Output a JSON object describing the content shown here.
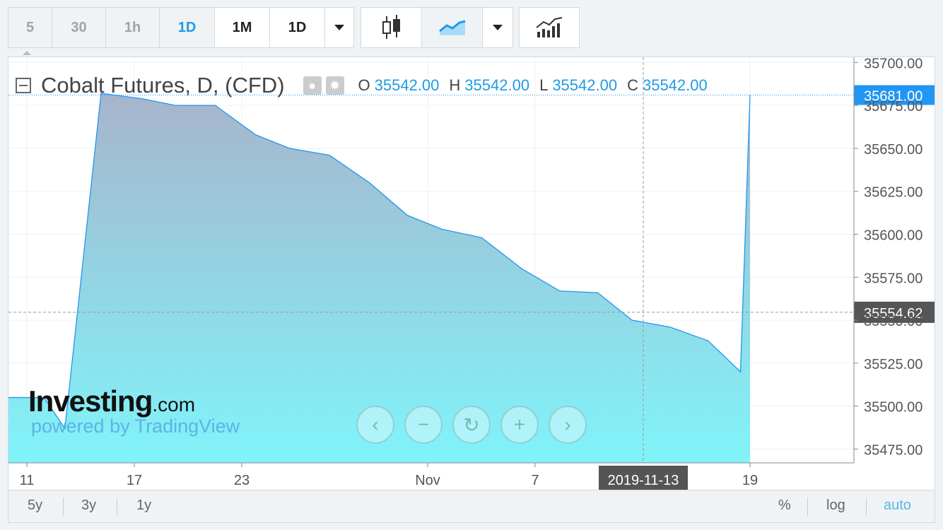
{
  "toolbar": {
    "intervals": [
      {
        "label": "5",
        "state": "disabled"
      },
      {
        "label": "30",
        "state": "disabled"
      },
      {
        "label": "1h",
        "state": "disabled"
      },
      {
        "label": "1D",
        "state": "active"
      },
      {
        "label": "1M",
        "state": "normal"
      },
      {
        "label": "1D",
        "state": "normal"
      }
    ]
  },
  "legend": {
    "title": "Cobalt Futures, D, (CFD)",
    "o_label": "O",
    "o_value": "35542.00",
    "h_label": "H",
    "h_value": "35542.00",
    "l_label": "L",
    "l_value": "35542.00",
    "c_label": "C",
    "c_value": "35542.00"
  },
  "price_labels": {
    "last": "35681.00",
    "crosshair": "35554.62",
    "crosshair_date": "2019-11-13"
  },
  "watermark": {
    "brand": "Investing",
    "domain": ".com",
    "powered": "powered by TradingView"
  },
  "bottom_bar": {
    "ranges": [
      "5y",
      "3y",
      "1y"
    ],
    "scale_options": [
      "%",
      "log",
      "auto"
    ]
  },
  "colors": {
    "line": "#2196f3",
    "accent": "#1e9be6",
    "fill_top": "#a7b4cc",
    "fill_bottom": "#80f4f9"
  },
  "chart_data": {
    "type": "area",
    "title": "Cobalt Futures, D, (CFD)",
    "xlabel": "",
    "ylabel": "",
    "x_ticks": [
      "11",
      "17",
      "23",
      "Nov",
      "7",
      "19"
    ],
    "y_ticks": [
      "35475.00",
      "35500.00",
      "35525.00",
      "35550.00",
      "35575.00",
      "35600.00",
      "35625.00",
      "35650.00",
      "35675.00",
      "35700.00"
    ],
    "ylim": [
      35467,
      35703
    ],
    "x": [
      -1.4,
      0.45,
      1.0,
      1.95,
      3.0,
      3.9,
      4.95,
      6.0,
      6.9,
      7.95,
      9.0,
      10.0,
      10.9,
      11.95,
      13.0,
      14.0,
      15.0,
      15.9,
      16.9,
      17.9,
      18.75,
      19.0
    ],
    "values": [
      35505,
      35505,
      35487,
      35682,
      35679,
      35675,
      35675,
      35658,
      35650,
      35646,
      35630,
      35611,
      35603,
      35598,
      35580,
      35567,
      35566,
      35550,
      35546,
      35538,
      35520,
      35681
    ],
    "grid": true,
    "last_value": 35681.0,
    "crosshair_value": 35554.62
  }
}
